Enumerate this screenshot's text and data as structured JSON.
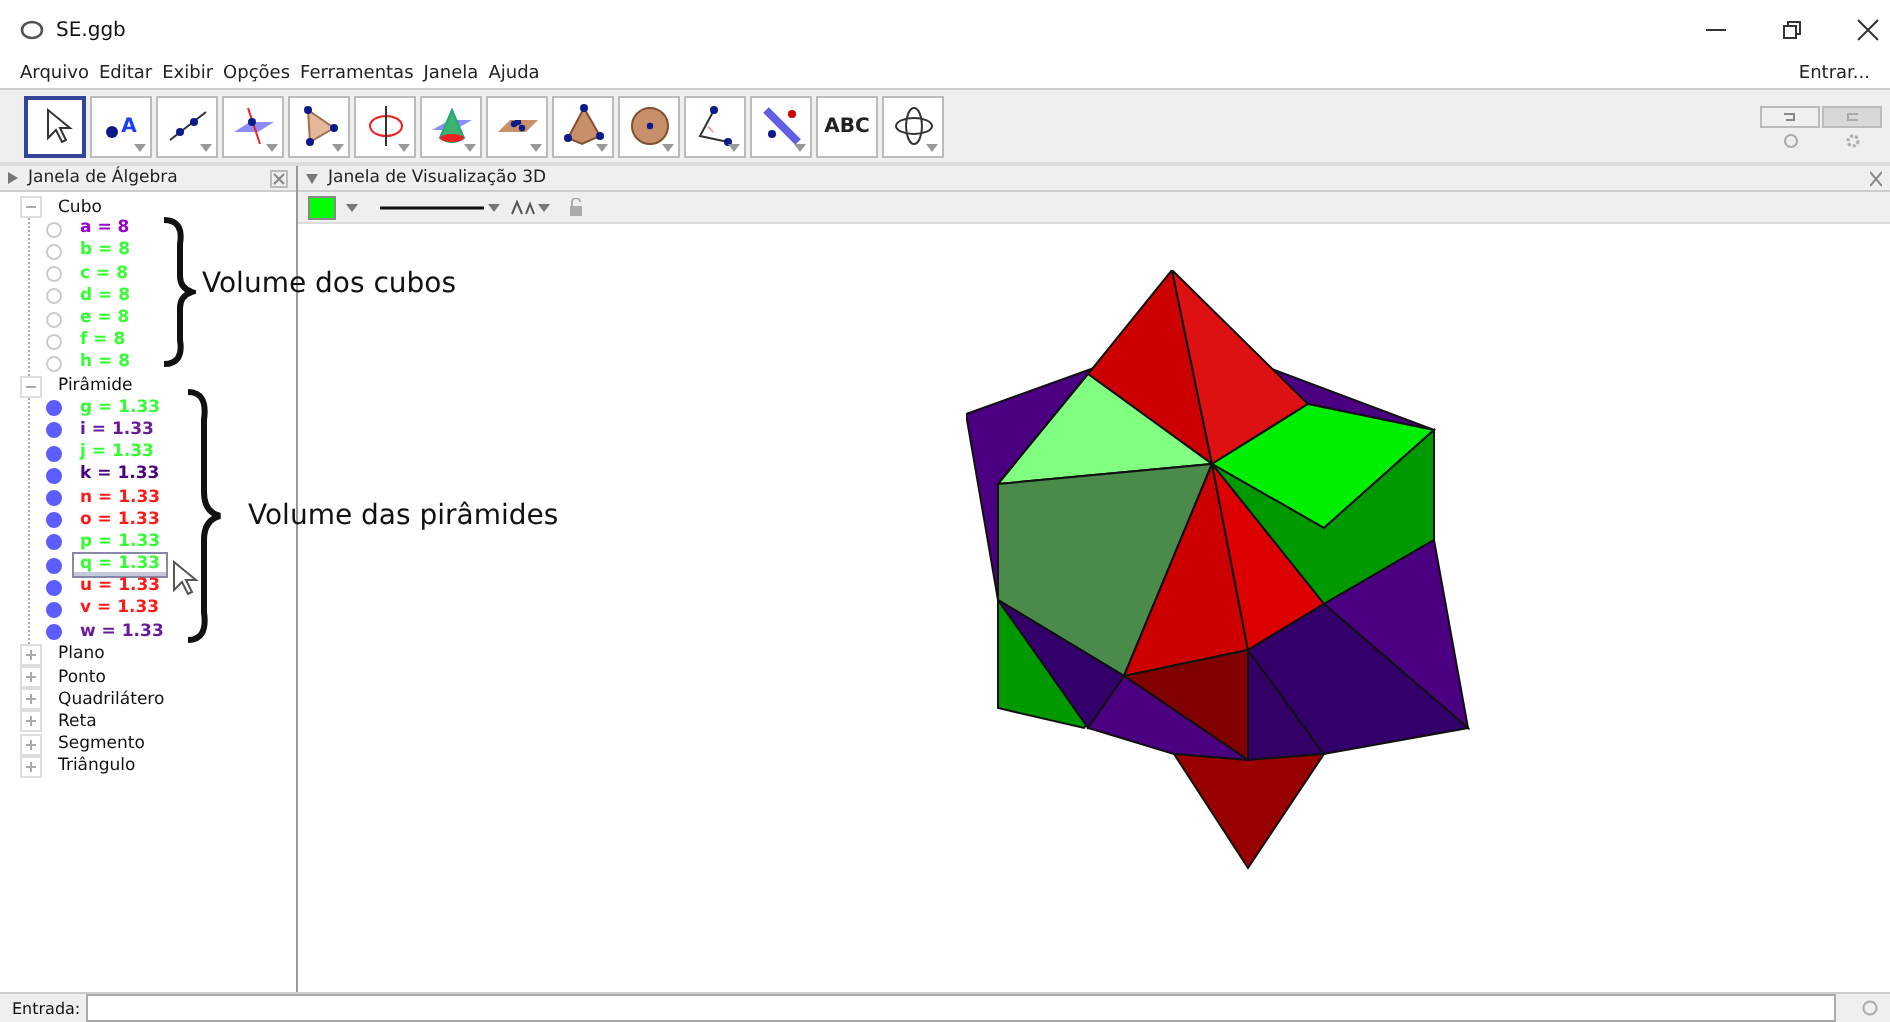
{
  "window": {
    "title": "SE.ggb"
  },
  "menu": [
    "Arquivo",
    "Editar",
    "Exibir",
    "Opções",
    "Ferramentas",
    "Janela",
    "Ajuda"
  ],
  "login": "Entrar...",
  "tools": [
    {
      "kind": "move",
      "selected": true
    },
    {
      "kind": "point",
      "selected": false,
      "label": "A"
    },
    {
      "kind": "line",
      "selected": false
    },
    {
      "kind": "plane-line",
      "selected": false
    },
    {
      "kind": "triangle",
      "selected": false
    },
    {
      "kind": "circle",
      "selected": false
    },
    {
      "kind": "cone",
      "selected": false
    },
    {
      "kind": "plane",
      "selected": false
    },
    {
      "kind": "pyramid",
      "selected": false
    },
    {
      "kind": "sphere",
      "selected": false
    },
    {
      "kind": "angle",
      "selected": false
    },
    {
      "kind": "reflect",
      "selected": false
    },
    {
      "kind": "text",
      "selected": false,
      "label": "ABC"
    },
    {
      "kind": "rotate",
      "selected": false
    }
  ],
  "algebra": {
    "title": "Janela de Álgebra",
    "groups": [
      {
        "name": "Cubo",
        "expanded": true,
        "items": [
          {
            "text": "a = 8",
            "color": "#9900cc",
            "visible": false,
            "selected": false
          },
          {
            "text": "b = 8",
            "color": "#33ff33",
            "visible": false,
            "selected": false
          },
          {
            "text": "c = 8",
            "color": "#33ff33",
            "visible": false,
            "selected": false
          },
          {
            "text": "d = 8",
            "color": "#33ff33",
            "visible": false,
            "selected": false
          },
          {
            "text": "e = 8",
            "color": "#33ff33",
            "visible": false,
            "selected": false
          },
          {
            "text": "f = 8",
            "color": "#33ff33",
            "visible": false,
            "selected": false
          },
          {
            "text": "h = 8",
            "color": "#33ff33",
            "visible": false,
            "selected": false
          }
        ]
      },
      {
        "name": "Pirâmide",
        "expanded": true,
        "items": [
          {
            "text": "g = 1.33",
            "color": "#33ff33",
            "visible": true,
            "selected": false
          },
          {
            "text": "i = 1.33",
            "color": "#6a1b9a",
            "visible": true,
            "selected": false
          },
          {
            "text": "j = 1.33",
            "color": "#33ff33",
            "visible": true,
            "selected": false
          },
          {
            "text": "k = 1.33",
            "color": "#4b0082",
            "visible": true,
            "selected": false
          },
          {
            "text": "n = 1.33",
            "color": "#ff1a1a",
            "visible": true,
            "selected": false
          },
          {
            "text": "o = 1.33",
            "color": "#ff1a1a",
            "visible": true,
            "selected": false
          },
          {
            "text": "p = 1.33",
            "color": "#33ff33",
            "visible": true,
            "selected": false
          },
          {
            "text": "q = 1.33",
            "color": "#33ff33",
            "visible": true,
            "selected": true
          },
          {
            "text": "u = 1.33",
            "color": "#ff1a1a",
            "visible": true,
            "selected": false
          },
          {
            "text": "v = 1.33",
            "color": "#ff1a1a",
            "visible": true,
            "selected": false
          },
          {
            "text": "w = 1.33",
            "color": "#6a1b9a",
            "visible": true,
            "selected": false
          }
        ]
      },
      {
        "name": "Plano",
        "expanded": false
      },
      {
        "name": "Ponto",
        "expanded": false
      },
      {
        "name": "Quadrilátero",
        "expanded": false
      },
      {
        "name": "Reta",
        "expanded": false
      },
      {
        "name": "Segmento",
        "expanded": false
      },
      {
        "name": "Triângulo",
        "expanded": false
      }
    ]
  },
  "annotations": [
    "Volume dos cubos",
    "Volume das pirâmides"
  ],
  "view3d": {
    "title": "Janela de Visualização 3D",
    "color": "#00ff00"
  },
  "input": {
    "label": "Entrada:"
  }
}
